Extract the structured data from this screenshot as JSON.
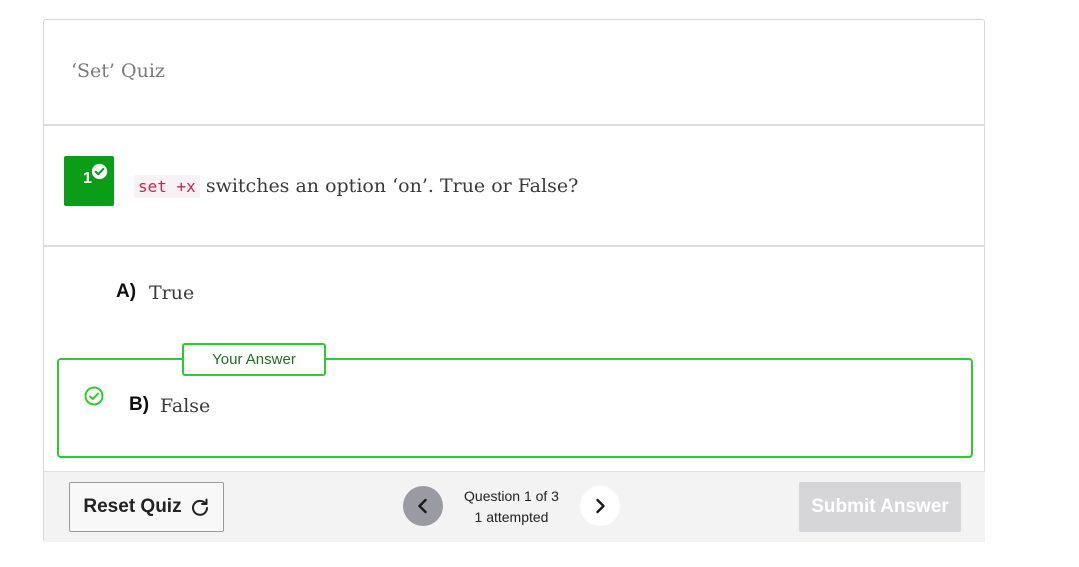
{
  "quiz": {
    "title": "‘Set’ Quiz"
  },
  "question": {
    "number": "1",
    "code": "set +x",
    "text": " switches an option ‘on’. True or False?",
    "answered_icon": "check-circle-icon"
  },
  "options": [
    {
      "letter": "A)",
      "text": "True"
    },
    {
      "letter": "B)",
      "text": "False"
    }
  ],
  "your_answer_label": "Your Answer",
  "footer": {
    "reset_label": "Reset Quiz",
    "reset_icon": "refresh-icon",
    "prev_icon": "chevron-left-icon",
    "next_icon": "chevron-right-icon",
    "progress_line1": "Question 1 of 3",
    "progress_line2": "1 attempted",
    "submit_label": "Submit Answer"
  },
  "colors": {
    "success": "#0a9d17",
    "answer_border": "#2dcc2d",
    "code_text": "#c7254e",
    "submit_disabled": "#d6d6d9",
    "prev_disabled": "#9a9aa2"
  }
}
